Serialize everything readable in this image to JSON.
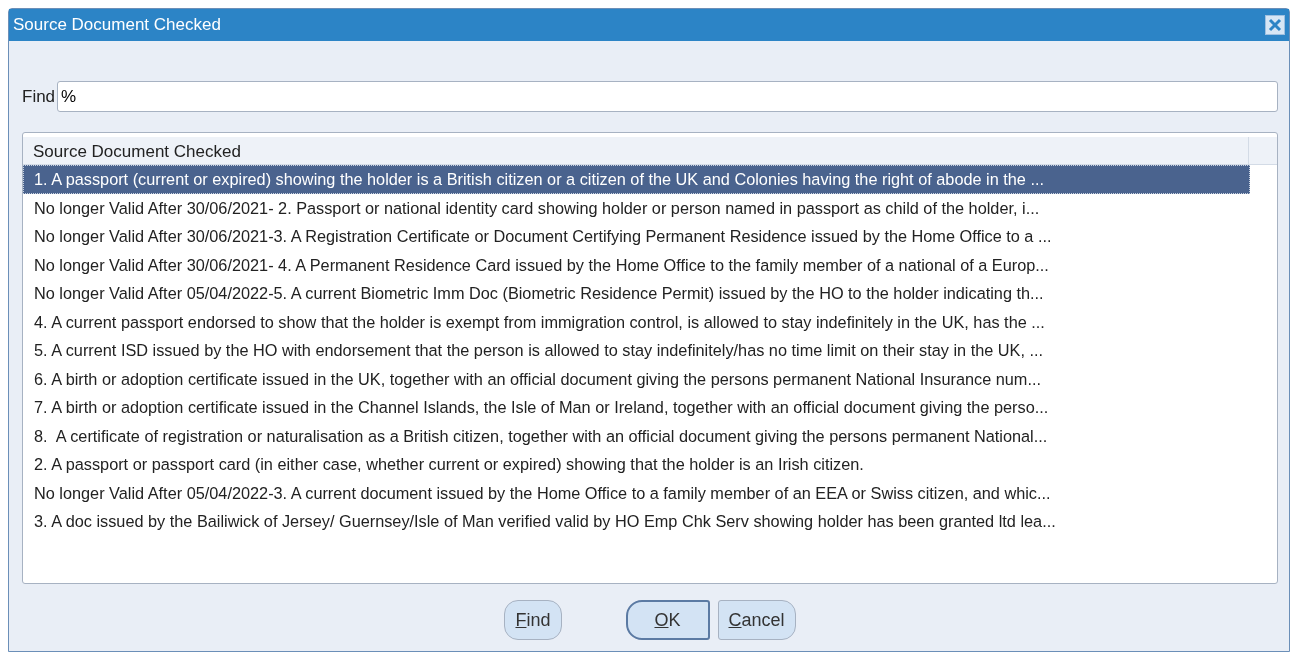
{
  "window": {
    "title": "Source Document Checked"
  },
  "find": {
    "label": "Find",
    "value": "%"
  },
  "list": {
    "column": "Source Document Checked",
    "rows": [
      {
        "text": "1. A passport (current or expired) showing the holder is a British citizen or a citizen of the UK and Colonies having the right of abode in the ...",
        "selected": true
      },
      {
        "text": "No longer Valid After 30/06/2021- 2. Passport or national identity card showing holder or person named in passport as child of the holder, i...",
        "selected": false
      },
      {
        "text": "No longer Valid After 30/06/2021-3. A Registration Certificate or Document Certifying Permanent Residence issued by the Home Office to a ...",
        "selected": false
      },
      {
        "text": "No longer Valid After 30/06/2021- 4. A Permanent Residence Card issued by the Home Office to the family member of a national of a Europ...",
        "selected": false
      },
      {
        "text": "No longer Valid After 05/04/2022-5. A current Biometric Imm Doc (Biometric Residence Permit) issued by the HO to the holder indicating th...",
        "selected": false
      },
      {
        "text": "4. A current passport endorsed to show that the holder is exempt from immigration control, is allowed to stay indefinitely in the UK, has the ...",
        "selected": false
      },
      {
        "text": "5. A current ISD issued by the HO with endorsement that the person is allowed to stay indefinitely/has no time limit on their stay in the UK, ...",
        "selected": false
      },
      {
        "text": "6. A birth or adoption certificate issued in the UK, together with an official document giving the persons permanent National Insurance num...",
        "selected": false
      },
      {
        "text": "7. A birth or adoption certificate issued in the Channel Islands, the Isle of Man or Ireland, together with an official document giving the perso...",
        "selected": false
      },
      {
        "text": "8.  A certificate of registration or naturalisation as a British citizen, together with an official document giving the persons permanent National...",
        "selected": false
      },
      {
        "text": "2. A passport or passport card (in either case, whether current or expired) showing that the holder is an Irish citizen.",
        "selected": false
      },
      {
        "text": "No longer Valid After 05/04/2022-3. A current document issued by the Home Office to a family member of an EEA or Swiss citizen, and whic...",
        "selected": false
      },
      {
        "text": "3. A doc issued by the Bailiwick of Jersey/ Guernsey/Isle of Man verified valid by HO Emp Chk Serv showing holder has been granted ltd lea...",
        "selected": false
      }
    ]
  },
  "buttons": [
    {
      "label": "Find",
      "default": false
    },
    {
      "label": "OK",
      "default": true
    },
    {
      "label": "Cancel",
      "default": false
    }
  ]
}
